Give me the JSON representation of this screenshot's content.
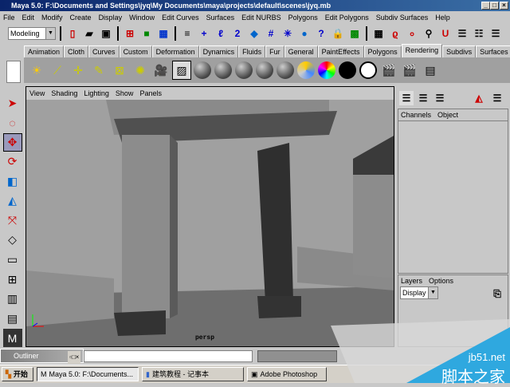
{
  "title": "Maya 5.0: F:\\Documents and Settings\\jyq\\My Documents\\maya\\projects\\default\\scenes\\jyq.mb",
  "menu": [
    "File",
    "Edit",
    "Modify",
    "Create",
    "Display",
    "Window",
    "Edit Curves",
    "Surfaces",
    "Edit NURBS",
    "Polygons",
    "Edit Polygons",
    "Subdiv Surfaces",
    "Help"
  ],
  "menuset": "Modeling",
  "shelf_tabs": [
    "Animation",
    "Cloth",
    "Curves",
    "Custom",
    "Deformation",
    "Dynamics",
    "Fluids",
    "Fur",
    "General",
    "PaintEffects",
    "Polygons",
    "Rendering",
    "Subdivs",
    "Surfaces"
  ],
  "active_tab": "Rendering",
  "viewport": {
    "menu": [
      "View",
      "Shading",
      "Lighting",
      "Show",
      "Panels"
    ],
    "camera": "persp"
  },
  "channel_box": {
    "menu": [
      "Channels",
      "Object"
    ]
  },
  "layers": {
    "menu": [
      "Layers",
      "Options"
    ],
    "display": "Display"
  },
  "outliner": {
    "title": "Outliner"
  },
  "taskbar": {
    "start": "开始",
    "items": [
      "Maya 5.0: F:\\Documents...",
      "建筑教程 - 记事本",
      "Adobe Photoshop"
    ]
  },
  "watermark": {
    "site": "jb51.net",
    "name": "脚本之家"
  }
}
